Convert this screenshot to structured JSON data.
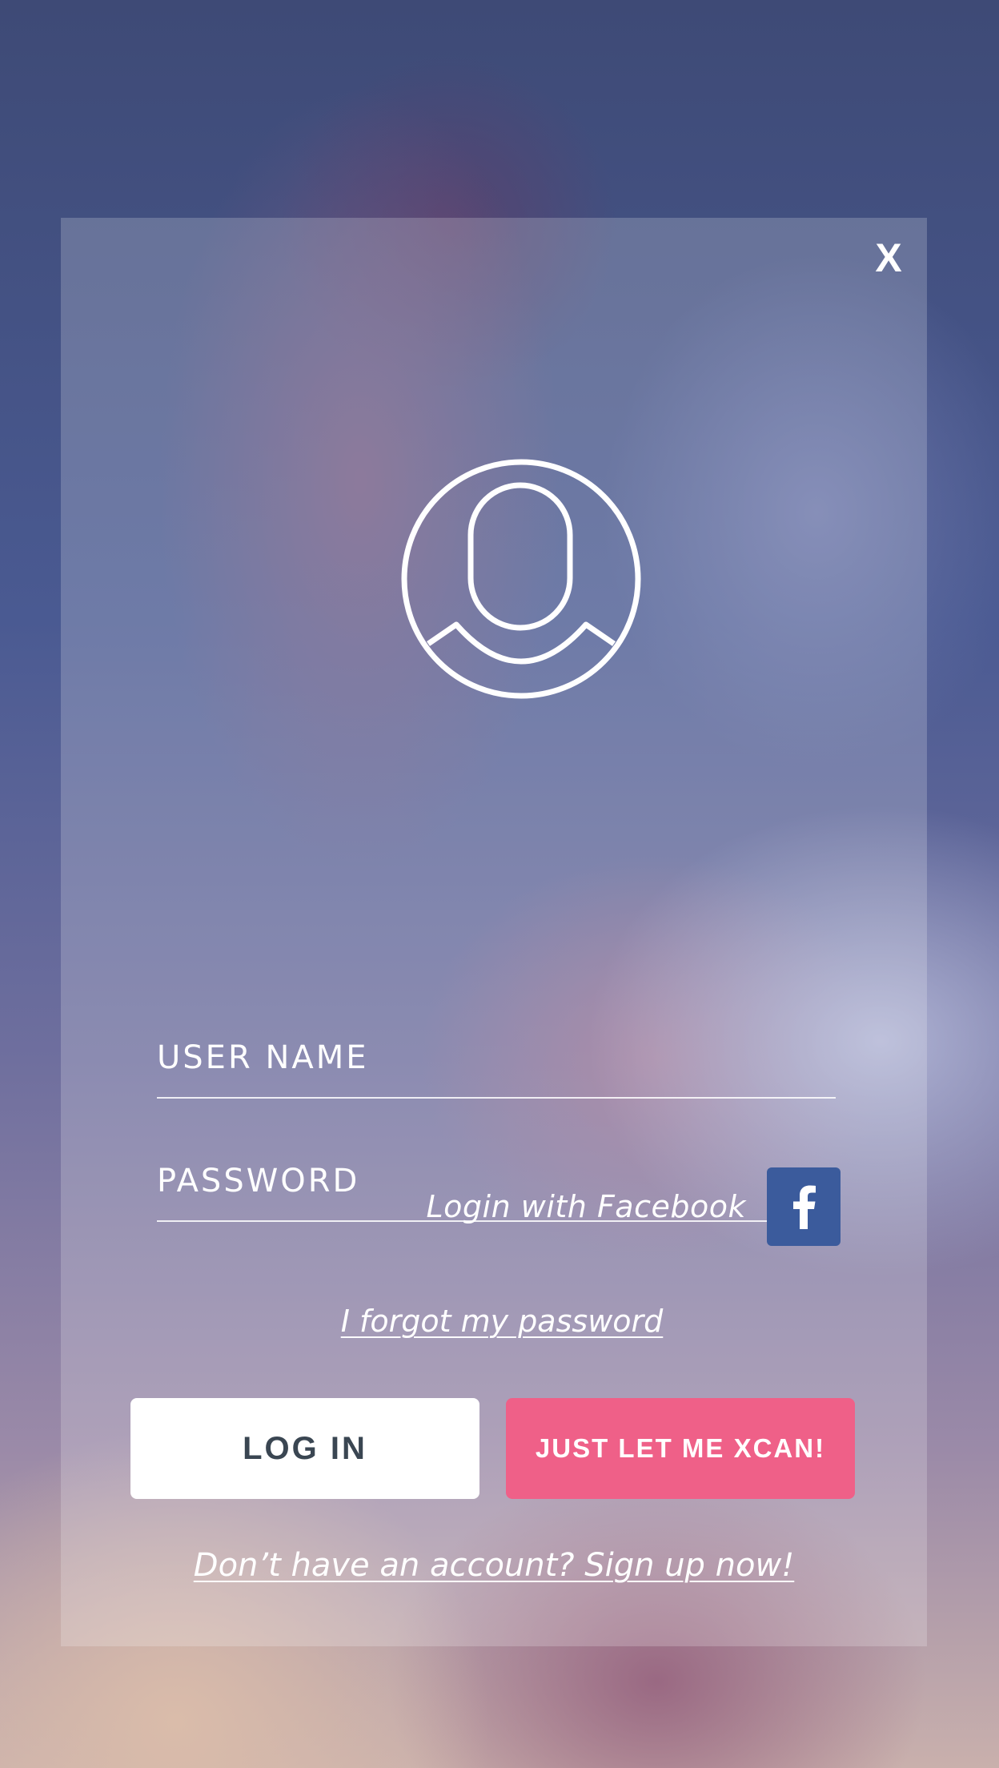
{
  "dialog": {
    "close_label": "X"
  },
  "form": {
    "username_placeholder": "USER NAME",
    "username_value": "",
    "password_placeholder": "PASSWORD",
    "password_value": ""
  },
  "links": {
    "forgot_password": "I forgot my password",
    "facebook_login": "Login with Facebook",
    "signup": "Don’t have an account? Sign up now!"
  },
  "buttons": {
    "login": "LOG IN",
    "guest": "JUST LET ME XCAN!"
  },
  "icons": {
    "close": "close-icon",
    "avatar": "user-avatar-icon",
    "facebook": "facebook-icon"
  },
  "colors": {
    "facebook_blue": "#3b5b9c",
    "guest_button_pink": "#ef6088",
    "login_button_text": "#3a4652"
  }
}
